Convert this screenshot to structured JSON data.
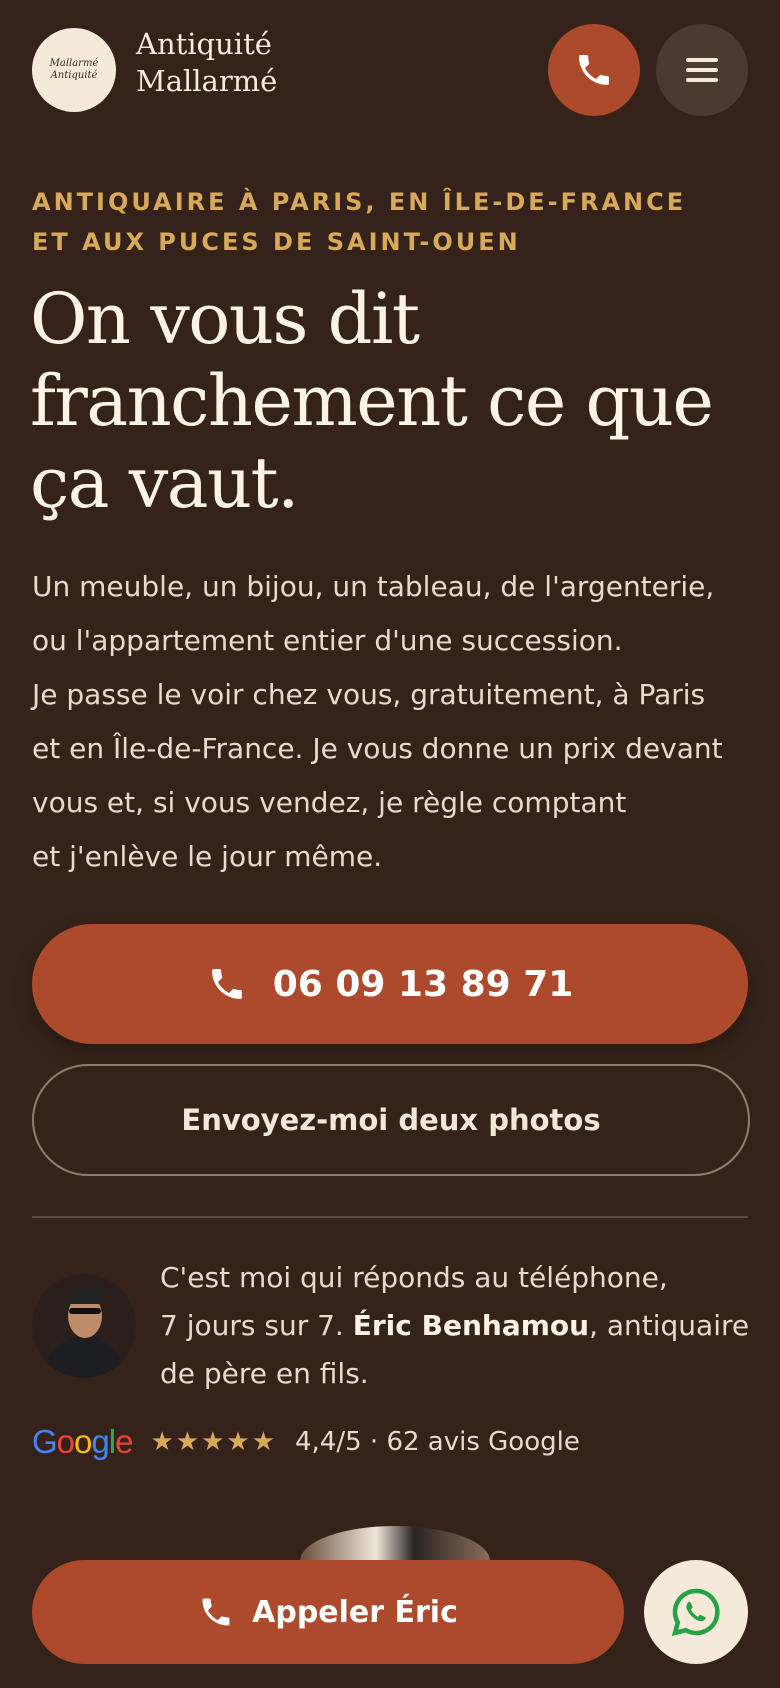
{
  "header": {
    "logo_badge_line1": "Mallarmé",
    "logo_badge_line2": "Antiquité",
    "brand_line1": "Antiquité",
    "brand_line2": "Mallarmé",
    "call_icon": "phone-icon",
    "menu_icon": "hamburger-menu-icon"
  },
  "hero": {
    "kicker_line1": "ANTIQUAIRE À PARIS, EN ÎLE-DE-FRANCE",
    "kicker_line2": "ET AUX PUCES DE SAINT-OUEN",
    "headline": "On vous dit franchement ce que ça vaut.",
    "body_lines": [
      "Un meuble, un bijou, un tableau, de l'argenterie,",
      "ou l'appartement entier d'une succession.",
      "Je passe le voir chez vous, gratuitement, à Paris",
      "et en Île-de-France. Je vous donne un prix devant",
      "vous et, si vous vendez, je règle comptant",
      "et j'enlève le jour même."
    ],
    "phone_button_label": "06 09 13 89 71",
    "photos_button_label": "Envoyez-moi deux photos"
  },
  "about": {
    "line1": "C'est moi qui réponds au téléphone,",
    "line2_prefix": "7 jours sur 7. ",
    "name": "Éric Benhamou",
    "line2_suffix": ", antiquaire",
    "line3": "de père en fils."
  },
  "rating": {
    "google_logo_text": "Google",
    "stars": "★★★★★",
    "text": "4,4/5 · 62 avis Google"
  },
  "sticky": {
    "call_label": "Appeler Éric",
    "whatsapp_icon": "whatsapp-icon"
  },
  "colors": {
    "background": "#35231b",
    "accent": "#ad4a2c",
    "gold": "#d9a95a",
    "cream": "#f5ead9"
  }
}
